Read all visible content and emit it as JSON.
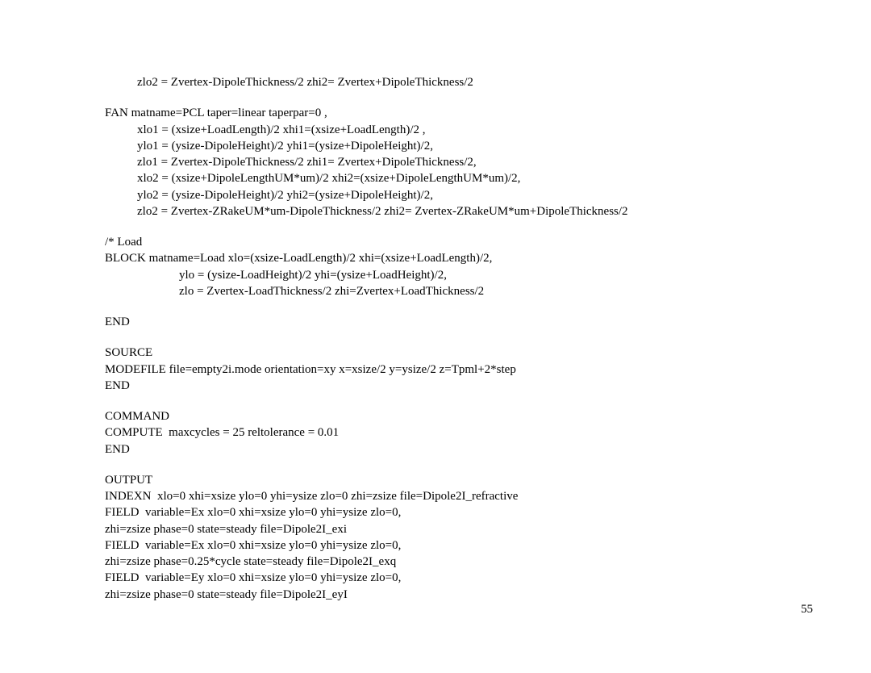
{
  "lines": {
    "l1": "zlo2 = Zvertex-DipoleThickness/2 zhi2= Zvertex+DipoleThickness/2",
    "l2": "FAN matname=PCL taper=linear taperpar=0 ,",
    "l3": "xlo1 = (xsize+LoadLength)/2 xhi1=(xsize+LoadLength)/2 ,",
    "l4": "ylo1 = (ysize-DipoleHeight)/2 yhi1=(ysize+DipoleHeight)/2,",
    "l5": "zlo1 = Zvertex-DipoleThickness/2 zhi1= Zvertex+DipoleThickness/2,",
    "l6": "xlo2 = (xsize+DipoleLengthUM*um)/2 xhi2=(xsize+DipoleLengthUM*um)/2,",
    "l7": "ylo2 = (ysize-DipoleHeight)/2 yhi2=(ysize+DipoleHeight)/2,",
    "l8": "zlo2 = Zvertex-ZRakeUM*um-DipoleThickness/2 zhi2= Zvertex-ZRakeUM*um+DipoleThickness/2",
    "l9": "/* Load",
    "l10": "BLOCK matname=Load xlo=(xsize-LoadLength)/2 xhi=(xsize+LoadLength)/2,",
    "l11": "ylo = (ysize-LoadHeight)/2 yhi=(ysize+LoadHeight)/2,",
    "l12": "zlo = Zvertex-LoadThickness/2 zhi=Zvertex+LoadThickness/2",
    "l13": "END",
    "l14": "SOURCE",
    "l15": "MODEFILE file=empty2i.mode orientation=xy x=xsize/2 y=ysize/2 z=Tpml+2*step",
    "l16": "END",
    "l17": "COMMAND",
    "l18": "COMPUTE  maxcycles = 25 reltolerance = 0.01",
    "l19": "END",
    "l20": "OUTPUT",
    "l21": "INDEXN  xlo=0 xhi=xsize ylo=0 yhi=ysize zlo=0 zhi=zsize file=Dipole2I_refractive",
    "l22": "FIELD  variable=Ex xlo=0 xhi=xsize ylo=0 yhi=ysize zlo=0,",
    "l23": "zhi=zsize phase=0 state=steady file=Dipole2I_exi",
    "l24": "FIELD  variable=Ex xlo=0 xhi=xsize ylo=0 yhi=ysize zlo=0,",
    "l25": "zhi=zsize phase=0.25*cycle state=steady file=Dipole2I_exq",
    "l26": "FIELD  variable=Ey xlo=0 xhi=xsize ylo=0 yhi=ysize zlo=0,",
    "l27": "zhi=zsize phase=0 state=steady file=Dipole2I_eyI"
  },
  "page_number": "55"
}
